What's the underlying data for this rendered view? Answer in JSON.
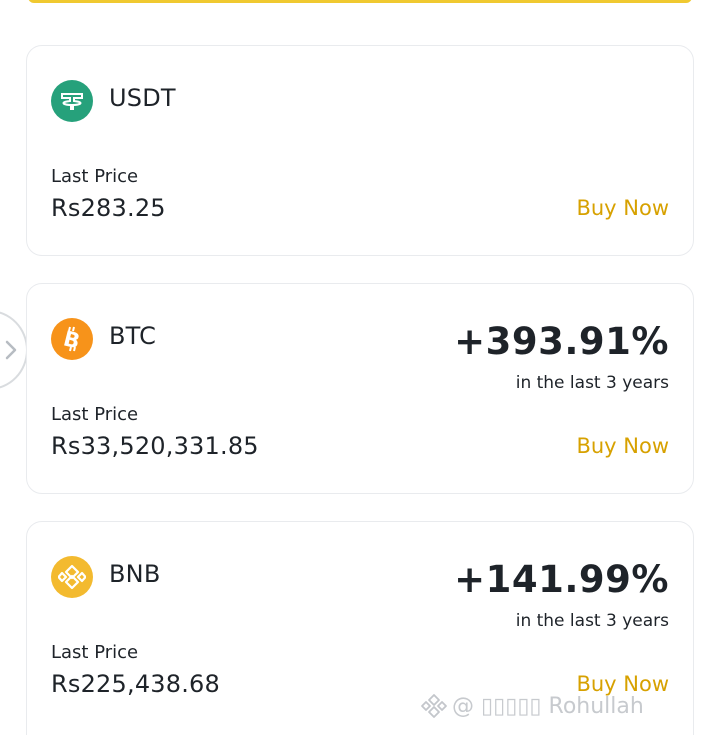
{
  "coins": [
    {
      "symbol": "USDT",
      "icon": "usdt-icon",
      "last_price_label": "Last Price",
      "last_price": "Rs283.25",
      "change": "",
      "change_period": "",
      "buy_label": "Buy Now"
    },
    {
      "symbol": "BTC",
      "icon": "bitcoin-icon",
      "last_price_label": "Last Price",
      "last_price": "Rs33,520,331.85",
      "change": "+393.91%",
      "change_period": "in the last 3 years",
      "buy_label": "Buy Now"
    },
    {
      "symbol": "BNB",
      "icon": "bnb-icon",
      "last_price_label": "Last Price",
      "last_price": "Rs225,438.68",
      "change": "+141.99%",
      "change_period": "in the last 3 years",
      "buy_label": "Buy Now"
    }
  ],
  "watermark": {
    "text": "@ ▯▯▯▯▯ Rohullah",
    "icon": "binance-logo-icon"
  },
  "colors": {
    "accent": "#d7a100",
    "usdt": "#26a17b",
    "btc": "#f7931a",
    "bnb": "#f3ba2f",
    "top_bar": "#f0c930"
  }
}
